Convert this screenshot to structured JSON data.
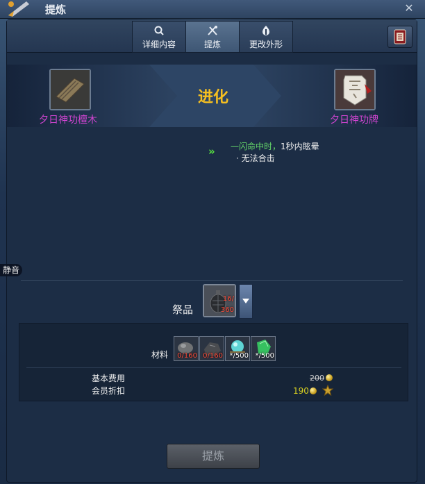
{
  "window": {
    "title": "提炼"
  },
  "tabs": [
    {
      "label": "详细内容",
      "icon": "magnifier-icon",
      "active": false
    },
    {
      "label": "提炼",
      "icon": "tools-icon",
      "active": true
    },
    {
      "label": "更改外形",
      "icon": "dye-icon",
      "active": false
    }
  ],
  "evolution": {
    "source_item": "夕日神功檀木",
    "label": "进化",
    "target_item": "夕日神功牌"
  },
  "effects": {
    "line1": {
      "highlight": "一闪命中时，",
      "normal": "1秒内眩晕"
    },
    "line2": {
      "bullet": "·",
      "text": "无法合击"
    }
  },
  "offering": {
    "label": "祭品",
    "count": "16/",
    "required": "360"
  },
  "materials": {
    "label": "材料",
    "items": [
      {
        "count": "0/160",
        "icon": "ore-icon",
        "insufficient": true
      },
      {
        "count": "0/160",
        "icon": "dark-ore-icon",
        "insufficient": true
      },
      {
        "count": "*/500",
        "icon": "cyan-orb-icon",
        "insufficient": false
      },
      {
        "count": "*/500",
        "icon": "green-crystal-icon",
        "insufficient": false
      }
    ]
  },
  "costs": {
    "base_label": "基本费用",
    "base_value": "200",
    "member_label": "会员折扣",
    "member_value": "190"
  },
  "refine_button": "提炼",
  "mute_badge": "静音",
  "colors": {
    "evolution_label": "#f6c020",
    "item_name": "#d245d2",
    "effect_highlight": "#66d96a"
  }
}
